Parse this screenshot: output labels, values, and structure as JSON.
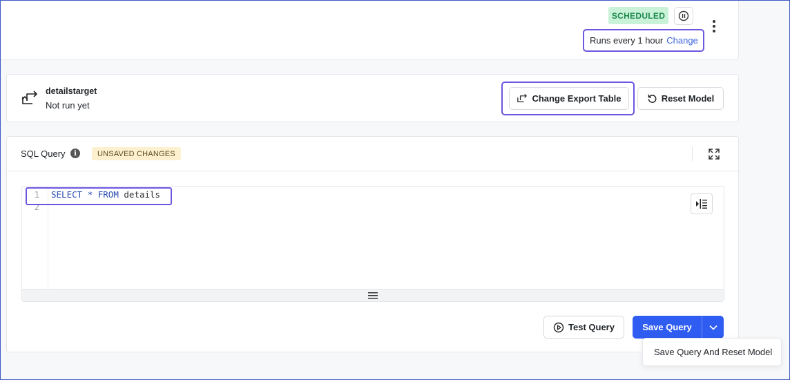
{
  "header": {
    "status_badge": "SCHEDULED",
    "schedule_text": "Runs every 1 hour",
    "schedule_change_link": "Change"
  },
  "model": {
    "name": "detailstarget",
    "status": "Not run yet",
    "change_export_label": "Change Export Table",
    "reset_label": "Reset Model"
  },
  "query": {
    "title": "SQL Query",
    "unsaved_badge": "UNSAVED CHANGES",
    "line_numbers": [
      "1",
      "2"
    ],
    "code": {
      "kw1": "SELECT",
      "star": "*",
      "kw2": "FROM",
      "table": "details"
    },
    "test_label": "Test Query",
    "save_label": "Save Query",
    "dropdown_item": "Save Query And Reset Model"
  },
  "colors": {
    "accent": "#2f5df2",
    "highlight": "#6b56e0",
    "scheduled_bg": "#c9f2d9",
    "scheduled_text": "#1d8a4b",
    "unsaved_bg": "#fcf0cf"
  },
  "icons": {
    "pause": "pause-circle-icon",
    "more": "more-vertical-icon",
    "model": "export-arrow-icon",
    "info": "info-icon",
    "expand": "expand-icon",
    "format": "format-indent-icon",
    "resize": "drag-handle-icon",
    "play": "play-circle-icon",
    "caret": "chevron-down-icon",
    "reset": "reset-icon"
  }
}
